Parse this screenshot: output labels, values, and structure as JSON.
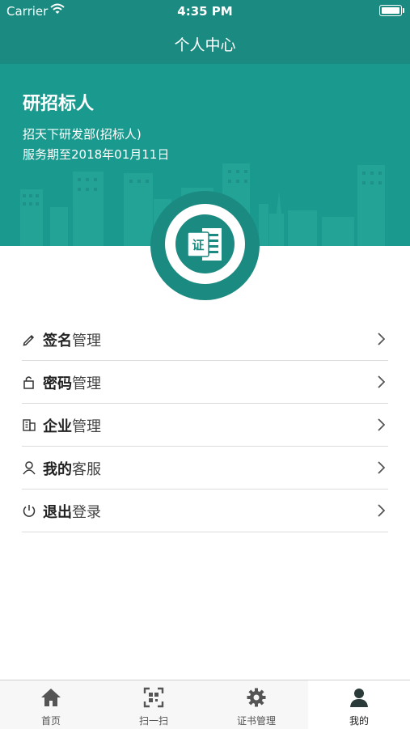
{
  "status_bar": {
    "carrier": "Carrier",
    "time": "4:35 PM"
  },
  "header": {
    "title": "个人中心"
  },
  "profile": {
    "name": "研招标人",
    "department": "招天下研发部(招标人)",
    "service_period": "服务期至2018年01月11日",
    "badge_icon": "certificate-icon"
  },
  "menu": [
    {
      "bold": "签名",
      "rest": "管理",
      "icon": "pencil-icon"
    },
    {
      "bold": "密码",
      "rest": "管理",
      "icon": "lock-icon"
    },
    {
      "bold": "企业",
      "rest": "管理",
      "icon": "building-icon"
    },
    {
      "bold": "我的",
      "rest": "客服",
      "icon": "user-icon"
    },
    {
      "bold": "退出",
      "rest": "登录",
      "icon": "power-icon"
    }
  ],
  "tabs": [
    {
      "label": "首页",
      "icon": "home-icon"
    },
    {
      "label": "扫一扫",
      "icon": "scan-icon"
    },
    {
      "label": "证书管理",
      "icon": "gear-icon"
    },
    {
      "label": "我的",
      "icon": "person-icon",
      "active": true
    }
  ],
  "colors": {
    "primary": "#1b8a80",
    "hero": "#1a9a8e",
    "tabbar_bg": "#f7f7f7"
  }
}
